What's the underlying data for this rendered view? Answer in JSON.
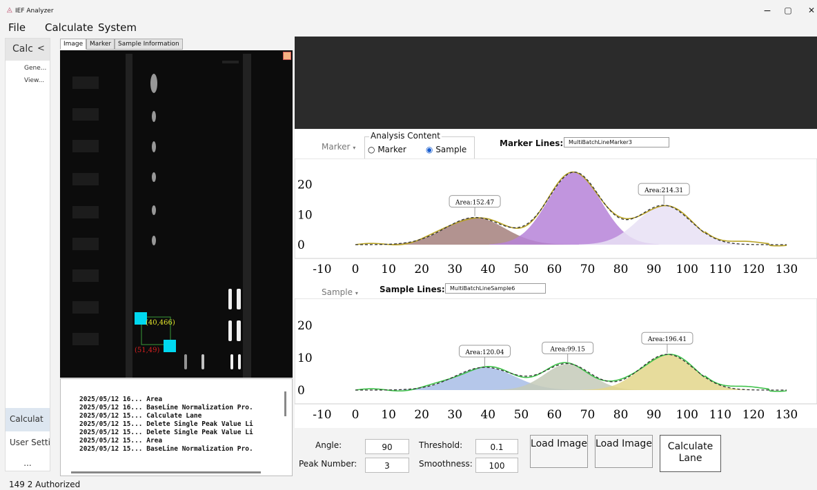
{
  "window": {
    "title": "IEF Analyzer",
    "minimize": "−",
    "maximize": "▢",
    "close": "✕"
  },
  "menu": [
    "File",
    "Calculate",
    "System"
  ],
  "nav": {
    "header": "Calc",
    "collapse": "<",
    "items": [
      "Gene...",
      "View..."
    ],
    "bottom": [
      "Calculat",
      "User Setti",
      "..."
    ]
  },
  "tabs": [
    "Image",
    "Marker",
    "Sample Information"
  ],
  "overlay": {
    "p1": "(40,466)",
    "p2": "(51,49)"
  },
  "log": [
    "2025/05/12 16... Area",
    "2025/05/12 16... BaseLine Normalization Pro.",
    "2025/05/12 15... Calculate Lane",
    "2025/05/12 15... Delete Single Peak Value Li",
    "2025/05/12 15... Delete Single Peak Value Li",
    "2025/05/12 15... Area",
    "2025/05/12 15... BaseLine Normalization Pro."
  ],
  "analysis": {
    "legend": "Analysis Content",
    "opt_marker": "Marker",
    "opt_sample": "Sample",
    "selected": "Sample",
    "marker_dropdown": "Marker",
    "sample_dropdown": "Sample",
    "marker_lines_label": "Marker Lines:",
    "marker_lines_value": "MultiBatchLineMarker3",
    "sample_lines_label": "Sample Lines:",
    "sample_lines_value": "MultiBatchLineSample6"
  },
  "controls": {
    "angle_label": "Angle:",
    "angle": "90",
    "threshold_label": "Threshold:",
    "threshold": "0.1",
    "peak_label": "Peak Number:",
    "peak": "3",
    "smooth_label": "Smoothness:",
    "smooth": "100",
    "btn_load1": "Load Image",
    "btn_load2": "Load Image",
    "btn_calc": "Calculate Lane"
  },
  "status": "149  2  Authorized",
  "chart_data": [
    {
      "type": "area",
      "x_ticks": [
        "-10",
        "0",
        "10",
        "20",
        "30",
        "40",
        "50",
        "60",
        "70",
        "80",
        "90",
        "100",
        "110",
        "120",
        "130"
      ],
      "y_ticks": [
        "0",
        "10",
        "20"
      ],
      "xlim": [
        -10,
        130
      ],
      "ylim": [
        -2,
        26
      ],
      "peaks": [
        {
          "center": 36,
          "height": 9,
          "width": 9,
          "color": "#a4807d",
          "label": "Area:152.47"
        },
        {
          "center": 66,
          "height": 24,
          "width": 8,
          "color": "#b683d8",
          "label": ""
        },
        {
          "center": 93,
          "height": 13,
          "width": 8,
          "color": "#e8e0f4",
          "label": "Area:214.31"
        }
      ],
      "raw_color": "#b9a325"
    },
    {
      "type": "area",
      "x_ticks": [
        "-10",
        "0",
        "10",
        "20",
        "30",
        "40",
        "50",
        "60",
        "70",
        "80",
        "90",
        "100",
        "110",
        "120",
        "130"
      ],
      "y_ticks": [
        "0",
        "10",
        "20"
      ],
      "xlim": [
        -10,
        130
      ],
      "ylim": [
        -2,
        26
      ],
      "peaks": [
        {
          "center": 39,
          "height": 7,
          "width": 9,
          "color": "#a8bde6",
          "label": "Area:120.04"
        },
        {
          "center": 64,
          "height": 8,
          "width": 7,
          "color": "#c4cab8",
          "label": "Area:99.15"
        },
        {
          "center": 94,
          "height": 11,
          "width": 8,
          "color": "#e3d68b",
          "label": "Area:196.41"
        }
      ],
      "raw_color": "#3ec24a"
    }
  ]
}
